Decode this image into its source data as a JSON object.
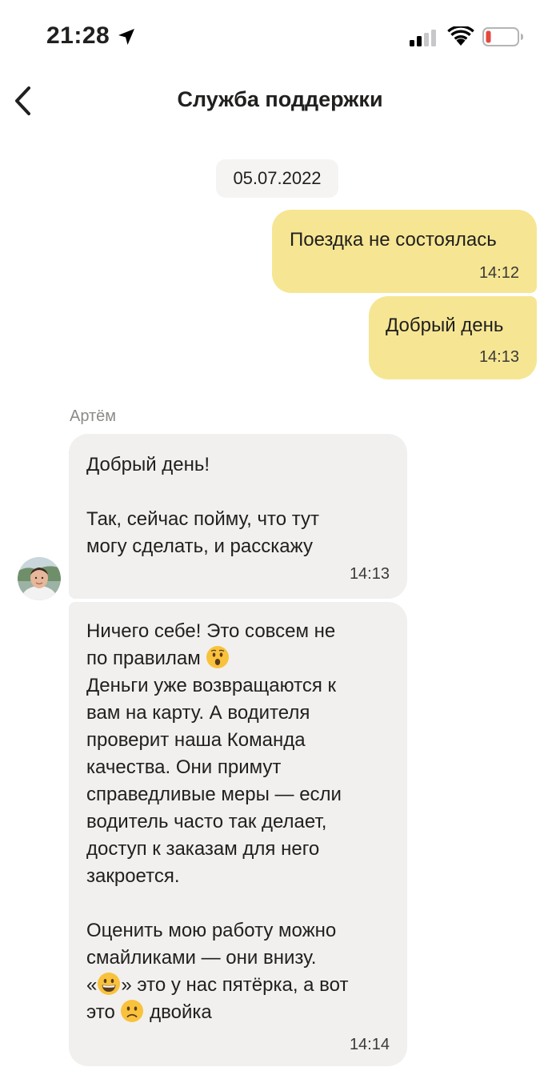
{
  "status_bar": {
    "time": "21:28",
    "icons": [
      "location-arrow-icon",
      "cellular-signal-icon",
      "wifi-icon",
      "battery-low-icon"
    ],
    "battery_color": "#e5483d"
  },
  "header": {
    "title": "Служба поддержки",
    "back_icon": "chevron-left-icon"
  },
  "chat": {
    "date": "05.07.2022",
    "outgoing_bubble_color": "#f6e693",
    "incoming_bubble_color": "#f1f0ee",
    "messages": [
      {
        "direction": "out",
        "text": "Поездка не состоялась",
        "time": "14:12"
      },
      {
        "direction": "out",
        "text": "Добрый день",
        "time": "14:13"
      },
      {
        "direction": "in",
        "sender": "Артём",
        "paragraph1": "Добрый день!",
        "paragraph2_line1": "Так, сейчас пойму, что тут",
        "paragraph2_line2": "могу сделать, и расскажу",
        "time": "14:13"
      },
      {
        "direction": "in",
        "line1": "Ничего себе! Это совсем не",
        "line2": "по правилам",
        "line2_emoji": "surprised-face-emoji",
        "line3": "Деньги уже возвращаются к",
        "line4": "вам на карту. А водителя",
        "line5": "проверит наша Команда",
        "line6": "качества. Они примут",
        "line7": "справедливые меры — если",
        "line8": "водитель часто так делает,",
        "line9": "доступ к заказам для него",
        "line10": "закроется.",
        "line11": "Оценить мою работу можно",
        "line12": "смайликами — они внизу.",
        "line13_prefix": "«",
        "line13_emoji": "grinning-face-emoji",
        "line13_suffix": "» это у нас пятёрка, а вот",
        "line14_prefix": "это",
        "line14_emoji": "slightly-frowning-face-emoji",
        "line14_suffix": "двойка",
        "time": "14:14"
      }
    ]
  }
}
